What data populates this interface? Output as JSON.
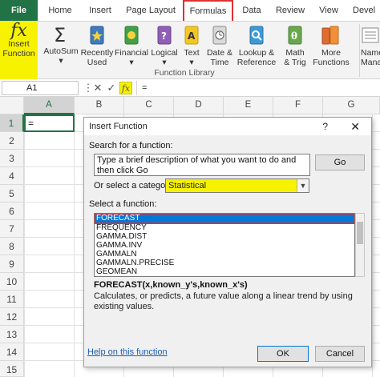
{
  "ribbon_tabs": {
    "file": "File",
    "home": "Home",
    "insert": "Insert",
    "page_layout": "Page Layout",
    "formulas": "Formulas",
    "data": "Data",
    "review": "Review",
    "view": "View",
    "developer": "Devel"
  },
  "ribbon": {
    "insert_function": [
      "Insert",
      "Function"
    ],
    "autosum": "AutoSum",
    "recently_used": [
      "Recently",
      "Used"
    ],
    "financial": "Financial",
    "logical": "Logical",
    "text": "Text",
    "date_time": [
      "Date &",
      "Time"
    ],
    "lookup_reference": [
      "Lookup &",
      "Reference"
    ],
    "math_trig": [
      "Math",
      "& Trig"
    ],
    "more_functions": [
      "More",
      "Functions"
    ],
    "name_manager": [
      "Name",
      "Mana"
    ],
    "group_label": "Function Library",
    "dropdown_arrow": "▾"
  },
  "formula_bar": {
    "name_box": "A1",
    "cancel_icon": "✕",
    "enter_icon": "✓",
    "fx_icon": "fx",
    "value": "=",
    "more_icon": "⋮"
  },
  "grid": {
    "columns": [
      "A",
      "B",
      "C",
      "D",
      "E",
      "F",
      "G"
    ],
    "rows": [
      "1",
      "2",
      "3",
      "4",
      "5",
      "6",
      "7",
      "8",
      "9",
      "10",
      "11",
      "12",
      "13",
      "14",
      "15"
    ],
    "cell_a1": "="
  },
  "dialog": {
    "title": "Insert Function",
    "help_glyph": "?",
    "close_glyph": "✕",
    "search_label": "Search for a function:",
    "search_text": "Type a brief description of what you want to do and then click Go",
    "go_button": "Go",
    "category_label": "Or select a category:",
    "category_value": "Statistical",
    "select_label": "Select a function:",
    "functions": [
      "FORECAST",
      "FREQUENCY",
      "GAMMA.DIST",
      "GAMMA.INV",
      "GAMMALN",
      "GAMMALN.PRECISE",
      "GEOMEAN"
    ],
    "selected_function": "FORECAST",
    "syntax": "FORECAST(x,known_y's,known_x's)",
    "description": "Calculates, or predicts, a future value along a linear trend by using existing values.",
    "help_link": "Help on this function",
    "ok_button": "OK",
    "cancel_button": "Cancel"
  },
  "colors": {
    "file_tab": "#217346",
    "highlight_yellow": "#f7f200",
    "annotation_red": "#e03030",
    "selection_blue": "#0078d7"
  }
}
